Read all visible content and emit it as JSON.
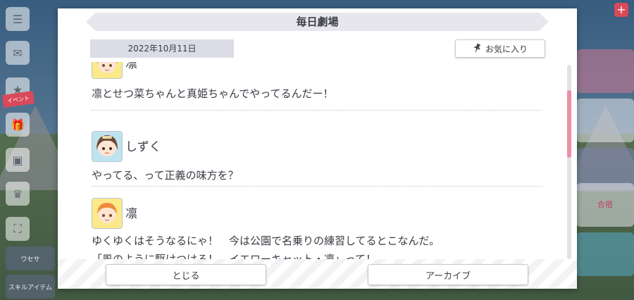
{
  "background": {
    "side_badges": [
      "イベント",
      "ワセサ",
      "スキルアイテム"
    ],
    "right_labels": [
      "合宿"
    ]
  },
  "dialog": {
    "title": "毎日劇場",
    "date": "2022年10月11日",
    "favorite_label": "お気に入り",
    "entries": [
      {
        "speaker": "凛",
        "lines": [
          "凛とせつ菜ちゃんと真姫ちゃんでやってるんだー！"
        ]
      },
      {
        "speaker": "しずく",
        "lines": [
          "やってる、って正義の味方を？"
        ]
      },
      {
        "speaker": "凛",
        "lines": [
          "ゆくゆくはそうなるにゃ！　今は公園で名乗りの練習してるとこなんだ。",
          "「風のように駆けつける！　イエローキャット・凛」って！"
        ]
      }
    ],
    "close_label": "とじる",
    "archive_label": "アーカイブ"
  },
  "colors": {
    "scroll_thumb": "#ef8fa3",
    "title_bar": "#e6e6ec",
    "date_chip": "#dcdce6",
    "text": "#3b3b45"
  }
}
